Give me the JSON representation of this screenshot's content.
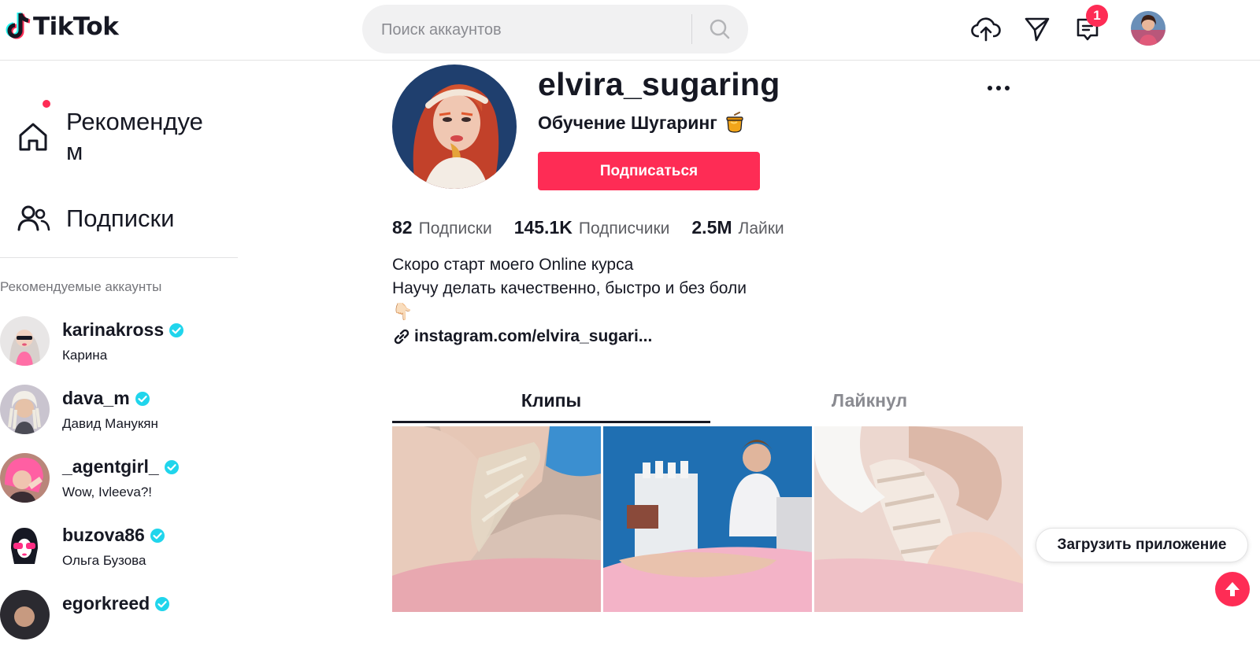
{
  "header": {
    "logo_text": "TikTok",
    "search_placeholder": "Поиск аккаунтов",
    "notification_count": "1",
    "icons": [
      "upload-icon",
      "send-icon",
      "inbox-icon"
    ]
  },
  "sidebar": {
    "nav": [
      {
        "label": "Рекомендуем",
        "icon": "home-icon"
      },
      {
        "label": "Подписки",
        "icon": "people-icon"
      }
    ],
    "suggested_title": "Рекомендуемые аккаунты",
    "accounts": [
      {
        "username": "karinakross",
        "name": "Карина",
        "verified": true
      },
      {
        "username": "dava_m",
        "name": "Давид Манукян",
        "verified": true
      },
      {
        "username": "_agentgirl_",
        "name": "Wow, Ivleeva?!",
        "verified": true
      },
      {
        "username": "buzova86",
        "name": "Ольга Бузова",
        "verified": true
      },
      {
        "username": "egorkreed",
        "name": "",
        "verified": true
      }
    ]
  },
  "profile": {
    "username": "elvira_sugaring",
    "display_name": "Обучение Шугаринг",
    "follow_label": "Подписаться",
    "stats": [
      {
        "value": "82",
        "label": "Подписки"
      },
      {
        "value": "145.1K",
        "label": "Подписчики"
      },
      {
        "value": "2.5M",
        "label": "Лайки"
      }
    ],
    "bio_lines": [
      "Скоро старт моего Online курса",
      "Научу делать качественно, быстро и без боли",
      "👇🏻"
    ],
    "link": "instagram.com/elvira_sugari..."
  },
  "tabs": [
    {
      "label": "Клипы",
      "active": true
    },
    {
      "label": "Лайкнул",
      "active": false
    }
  ],
  "floating": {
    "get_app_label": "Загрузить приложение"
  },
  "colors": {
    "accent": "#fe2c55",
    "text": "#161823",
    "secondary_text": "#75767b",
    "verified": "#20d5ec"
  }
}
